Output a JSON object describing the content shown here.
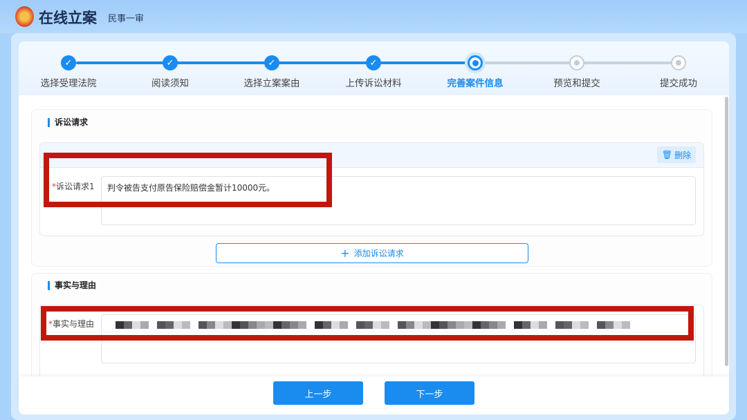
{
  "header": {
    "title": "在线立案",
    "subtitle": "民事一审"
  },
  "steps": [
    {
      "label": "选择受理法院",
      "state": "done"
    },
    {
      "label": "阅读须知",
      "state": "done"
    },
    {
      "label": "选择立案案由",
      "state": "done"
    },
    {
      "label": "上传诉讼材料",
      "state": "done"
    },
    {
      "label": "完善案件信息",
      "state": "current"
    },
    {
      "label": "预览和提交",
      "state": "todo"
    },
    {
      "label": "提交成功",
      "state": "todo"
    }
  ],
  "claims": {
    "title": "诉讼请求",
    "delete_label": "删除",
    "items": [
      {
        "required": "*",
        "label": "诉讼请求1",
        "value": "判令被告支付原告保险赔偿金暂计10000元。"
      }
    ],
    "add_label": "添加诉讼请求"
  },
  "facts": {
    "title": "事实与理由",
    "required": "*",
    "label": "事实与理由"
  },
  "footer": {
    "prev": "上一步",
    "next": "下一步"
  },
  "colors": {
    "accent": "#1a8cf0",
    "annotation": "#c0180c"
  }
}
